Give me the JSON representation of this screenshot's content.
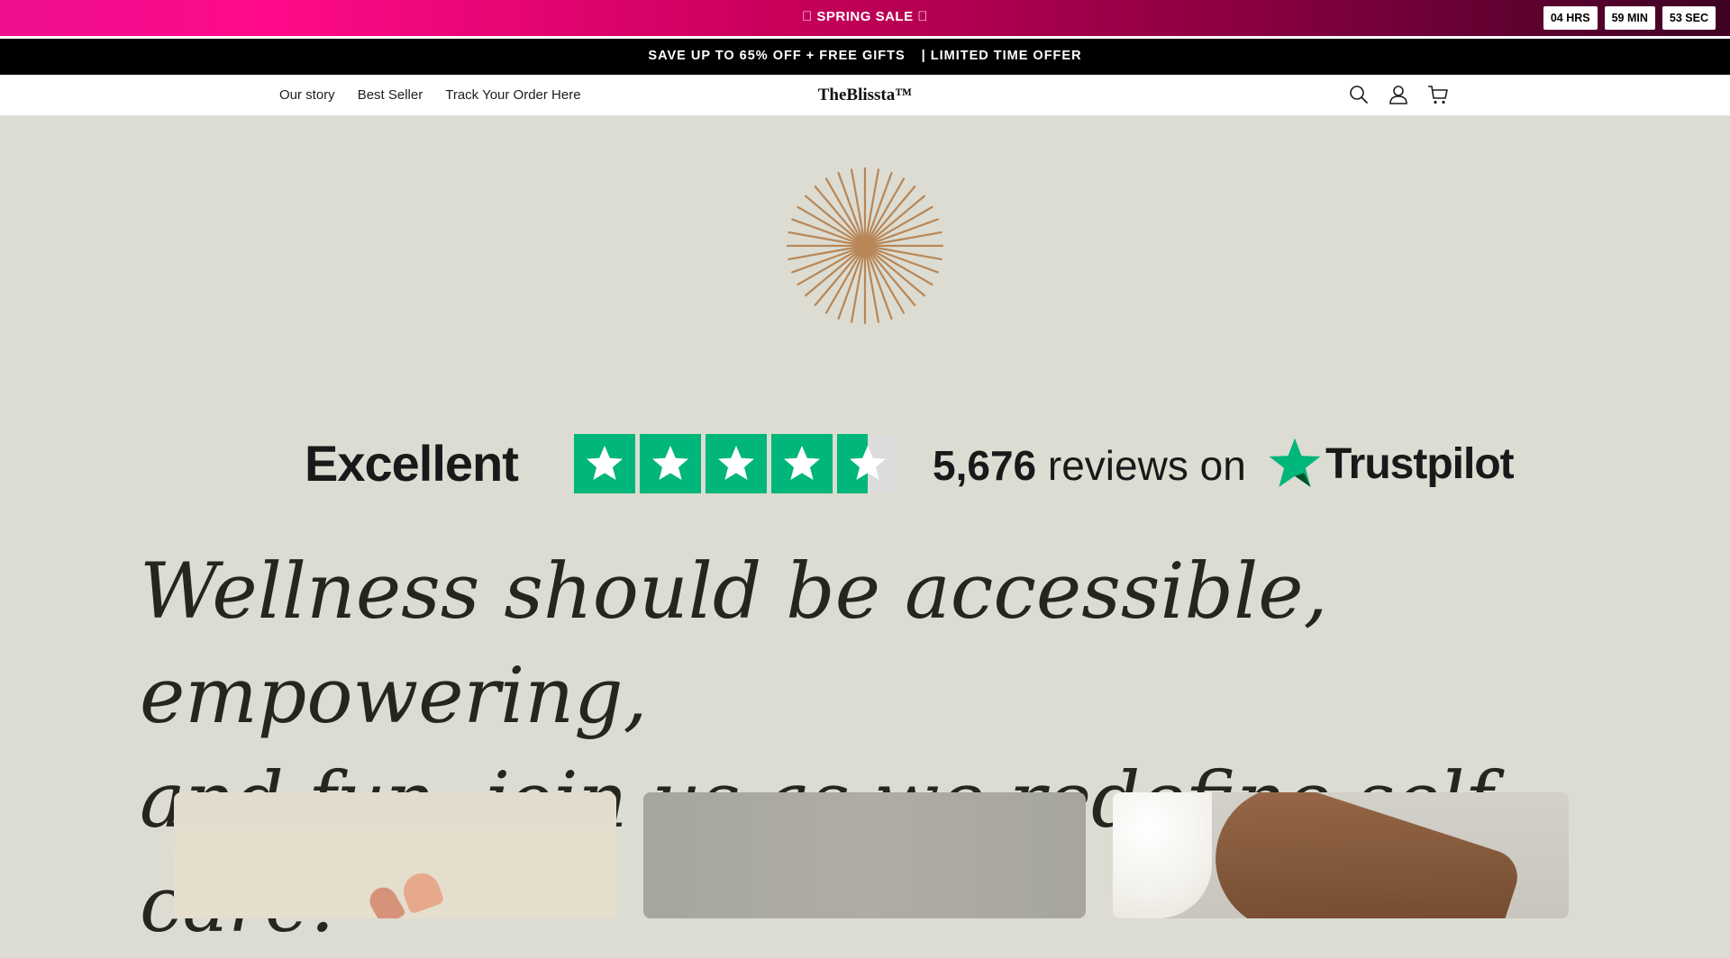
{
  "sale_bar": {
    "title": "\u0000 SPRING SALE \u0000",
    "timer": {
      "hours": "04 HRS",
      "minutes": "59 MIN",
      "seconds": "53 SEC"
    }
  },
  "promo_bar": {
    "text": "SAVE UP TO 65% OFF + FREE GIFTS",
    "text2": "| LIMITED TIME OFFER"
  },
  "header": {
    "nav": [
      "Our story",
      "Best Seller",
      "Track Your Order Here"
    ],
    "logo": "TheBlissta™",
    "icons": [
      "search-icon",
      "account-icon",
      "cart-icon"
    ]
  },
  "trust": {
    "rating_word": "Excellent",
    "stars": 4.5,
    "review_count": "5,676",
    "review_suffix": "reviews on",
    "platform": "Trustpilot",
    "star_color": "#00b67a"
  },
  "hero": {
    "headline_line1": "Wellness should be accessible, empowering,",
    "headline_line2": "and fun. join us as we redefine self-care."
  },
  "colors": {
    "page_background": "#dcdcd2",
    "accent_pink": "#ff0a8a",
    "starburst": "#b98757"
  }
}
